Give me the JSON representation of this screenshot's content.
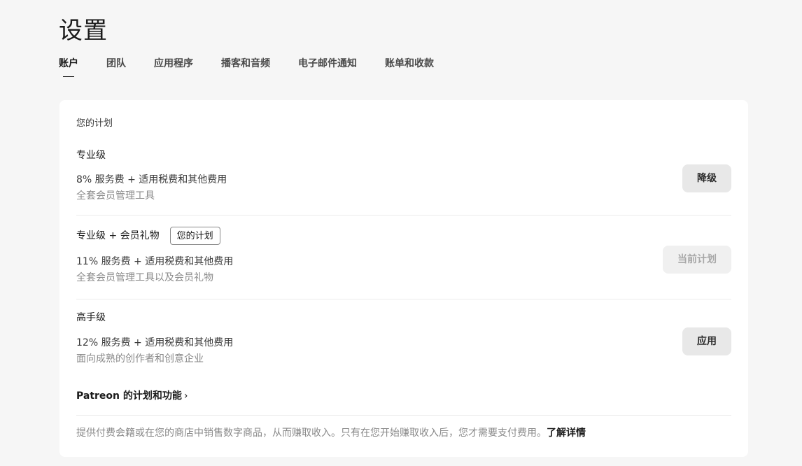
{
  "page": {
    "title": "设置"
  },
  "tabs": [
    {
      "label": "账户",
      "active": true
    },
    {
      "label": "团队"
    },
    {
      "label": "应用程序"
    },
    {
      "label": "播客和音频"
    },
    {
      "label": "电子邮件通知"
    },
    {
      "label": "账单和收款"
    }
  ],
  "card": {
    "heading": "您的计划",
    "plans": [
      {
        "name": "专业级",
        "fee": "8% 服务费 + 适用税费和其他费用",
        "desc": "全套会员管理工具",
        "button": "降级"
      },
      {
        "name": "专业级 + 会员礼物",
        "badge": "您的计划",
        "fee": "11% 服务费 + 适用税费和其他费用",
        "desc": "全套会员管理工具以及会员礼物",
        "button": "当前计划"
      },
      {
        "name": "高手级",
        "fee": "12% 服务费 + 适用税费和其他费用",
        "desc": "面向成熟的创作者和创意企业",
        "button": "应用"
      }
    ],
    "features_link": "Patreon 的计划和功能",
    "footer_note": "提供付费会籍或在您的商店中销售数字商品，从而赚取收入。只有在您开始赚取收入后，您才需要支付费用。",
    "learn_more": "了解详情"
  },
  "colors": {
    "background": "#f6f6f6",
    "card": "#ffffff",
    "button": "#e8e8e8",
    "button_disabled": "#f0f0f0"
  }
}
